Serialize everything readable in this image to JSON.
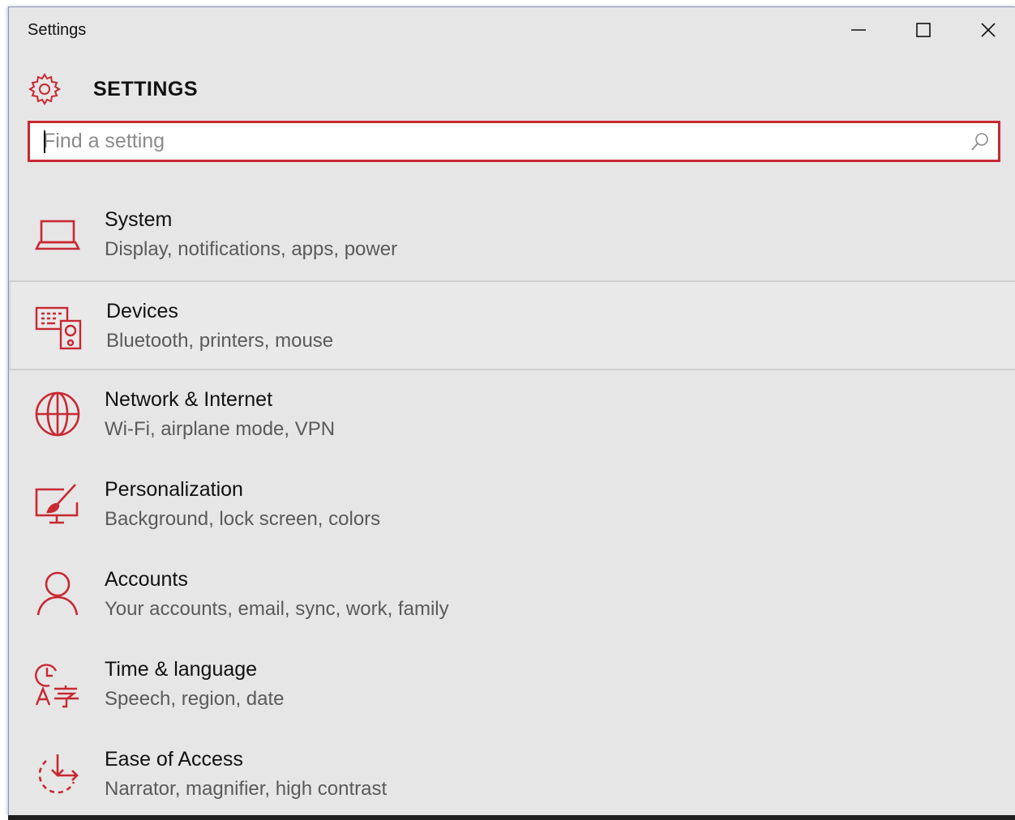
{
  "window": {
    "title": "Settings",
    "minimize_label": "Minimize",
    "maximize_label": "Maximize",
    "close_label": "Close"
  },
  "header": {
    "title": "SETTINGS",
    "icon": "gear-icon"
  },
  "search": {
    "placeholder": "Find a setting",
    "value": "",
    "icon": "search-icon"
  },
  "categories": [
    {
      "title": "System",
      "subtitle": "Display, notifications, apps, power",
      "icon": "laptop-icon"
    },
    {
      "title": "Devices",
      "subtitle": "Bluetooth, printers, mouse",
      "icon": "devices-icon"
    },
    {
      "title": "Network & Internet",
      "subtitle": "Wi-Fi, airplane mode, VPN",
      "icon": "globe-icon"
    },
    {
      "title": "Personalization",
      "subtitle": "Background, lock screen, colors",
      "icon": "paint-monitor-icon"
    },
    {
      "title": "Accounts",
      "subtitle": "Your accounts, email, sync, work, family",
      "icon": "person-icon"
    },
    {
      "title": "Time & language",
      "subtitle": "Speech, region, date",
      "icon": "time-language-icon"
    },
    {
      "title": "Ease of Access",
      "subtitle": "Narrator, magnifier, high contrast",
      "icon": "ease-of-access-icon"
    }
  ],
  "colors": {
    "accent": "#c82832",
    "window_bg": "#e6e6e6",
    "subtitle": "#5a5a5a"
  }
}
